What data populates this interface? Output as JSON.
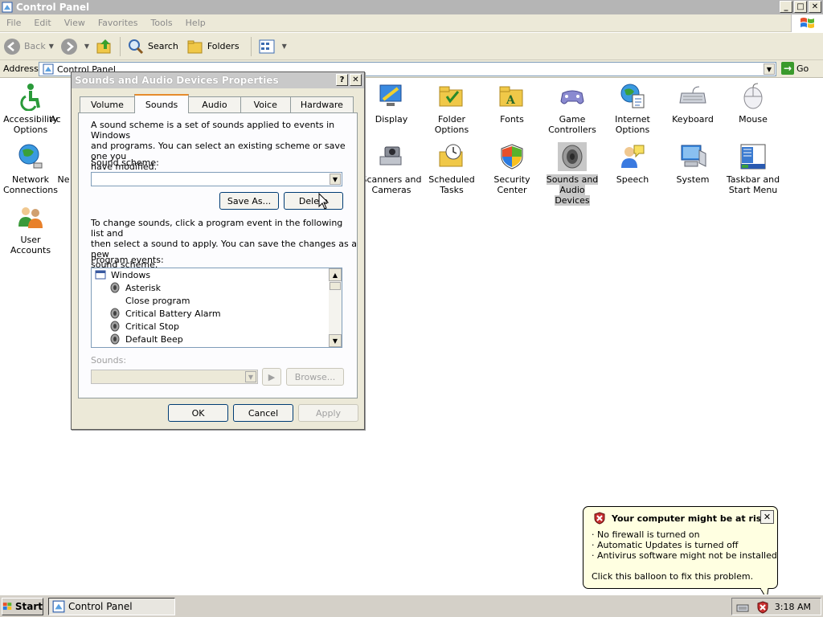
{
  "window": {
    "title": "Control Panel"
  },
  "menu": [
    "File",
    "Edit",
    "View",
    "Favorites",
    "Tools",
    "Help"
  ],
  "toolbar": {
    "back": "Back",
    "search": "Search",
    "folders": "Folders"
  },
  "address": {
    "label": "Address",
    "value": "Control Panel",
    "go": "Go"
  },
  "control_panel_items": [
    {
      "label": "Accessibility Options"
    },
    {
      "label": "Ac"
    },
    {
      "label": "Display"
    },
    {
      "label": "Folder Options"
    },
    {
      "label": "Fonts"
    },
    {
      "label": "Game Controllers"
    },
    {
      "label": "Internet Options"
    },
    {
      "label": "Keyboard"
    },
    {
      "label": "Mouse"
    },
    {
      "label": "Network Connections"
    },
    {
      "label": "Ne"
    },
    {
      "label": "Scanners and Cameras"
    },
    {
      "label": "Scheduled Tasks"
    },
    {
      "label": "Security Center"
    },
    {
      "label": "Sounds and Audio Devices"
    },
    {
      "label": "Speech"
    },
    {
      "label": "System"
    },
    {
      "label": "Taskbar and Start Menu"
    },
    {
      "label": "User Accounts"
    }
  ],
  "dialog": {
    "title": "Sounds and Audio Devices Properties",
    "tabs": [
      "Volume",
      "Sounds",
      "Audio",
      "Voice",
      "Hardware"
    ],
    "active_tab": "Sounds",
    "intro_text": [
      "A sound scheme is a set of sounds applied to events in Windows",
      "and programs. You can select an existing scheme or save one you",
      "have modified."
    ],
    "sound_scheme_label": "Sound scheme:",
    "sound_scheme_value": "",
    "save_as": "Save As...",
    "delete": "Delete",
    "change_text": [
      "To change sounds, click a program event in the following list and",
      "then select a sound to apply. You can save the changes as a new",
      "sound scheme."
    ],
    "program_events_label": "Program events:",
    "program_events": [
      {
        "label": "Windows",
        "type": "group"
      },
      {
        "label": "Asterisk",
        "type": "sound"
      },
      {
        "label": "Close program",
        "type": "none"
      },
      {
        "label": "Critical Battery Alarm",
        "type": "sound"
      },
      {
        "label": "Critical Stop",
        "type": "sound"
      },
      {
        "label": "Default Beep",
        "type": "sound"
      }
    ],
    "sounds_label": "Sounds:",
    "browse": "Browse...",
    "ok": "OK",
    "cancel": "Cancel",
    "apply": "Apply"
  },
  "balloon": {
    "title": "Your computer might be at risk",
    "lines": [
      "· No firewall is turned on",
      "· Automatic Updates is turned off",
      "· Antivirus software might not be installed"
    ],
    "footer": "Click this balloon to fix this problem."
  },
  "taskbar": {
    "start": "Start",
    "task": "Control Panel",
    "clock": "3:18 AM"
  },
  "colors": {
    "selection": "#c8c8c8",
    "balloon_bg": "#ffffe1",
    "tab_highlight": "#e68b2c"
  }
}
